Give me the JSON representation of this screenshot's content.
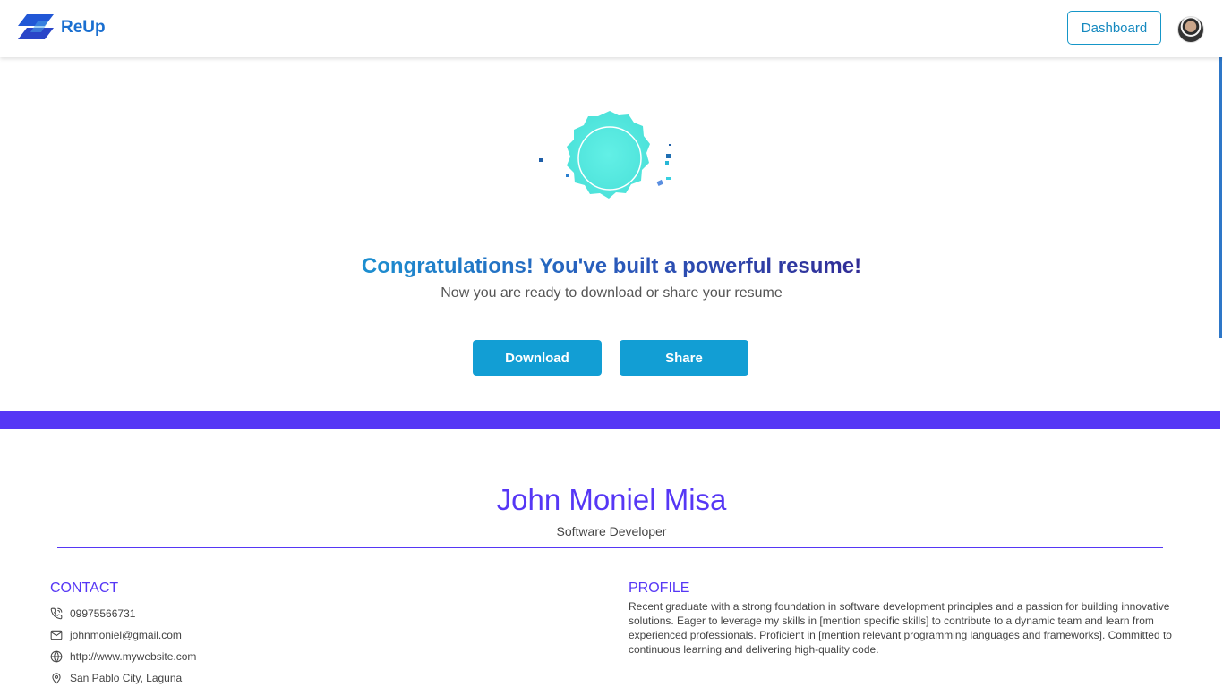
{
  "header": {
    "brand": "ReUp",
    "dashboard_label": "Dashboard"
  },
  "hero": {
    "title": "Congratulations! You've built a powerful resume!",
    "subtitle": "Now you are ready to download or share your resume",
    "download_label": "Download",
    "share_label": "Share"
  },
  "colors": {
    "primary_button": "#129ed4",
    "resume_accent": "#5637f5",
    "badge": "#5eeadf"
  },
  "resume": {
    "name": "John Moniel Misa",
    "role": "Software Developer",
    "contact_title": "CONTACT",
    "contact": [
      {
        "icon": "phone-icon",
        "text": "09975566731"
      },
      {
        "icon": "mail-icon",
        "text": "johnmoniel@gmail.com"
      },
      {
        "icon": "globe-icon",
        "text": "http://www.mywebsite.com"
      },
      {
        "icon": "location-pin-icon",
        "text": "San Pablo City, Laguna"
      }
    ],
    "profile_title": "PROFILE",
    "profile_text": "Recent graduate with a strong foundation in software development principles and a passion for building innovative solutions. Eager to leverage my skills in [mention specific skills] to contribute to a dynamic team and learn from experienced professionals. Proficient in [mention relevant programming languages and frameworks]. Committed to continuous learning and delivering high-quality code."
  }
}
